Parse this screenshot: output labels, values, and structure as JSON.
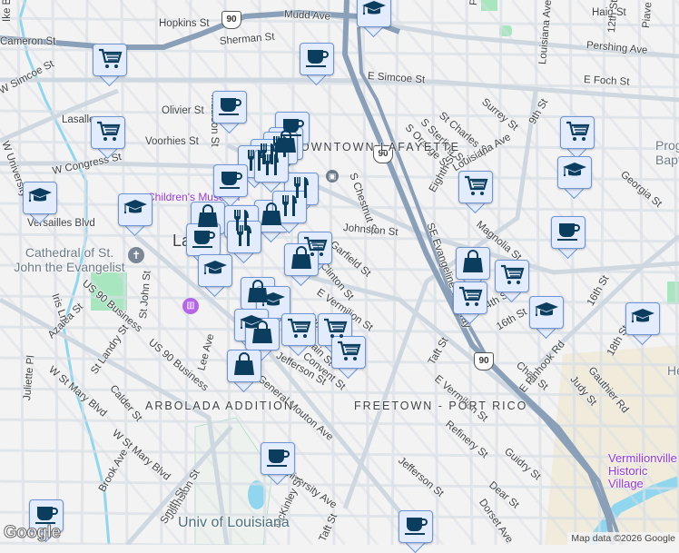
{
  "map": {
    "streets": [
      "Hopkins St",
      "Mudd Ave",
      "Cameron St",
      "Sherman St",
      "W Simcoe St",
      "E Simcoe St",
      "Olivier St",
      "Voorhies St",
      "Lasalle",
      "Madison St",
      "W Congress St",
      "W University",
      "Versailles Blvd",
      "Haig St",
      "Pershing Ave",
      "E Foch St",
      "Louisiana Ave",
      "Park Ave",
      "12th St",
      "Piave St",
      "Surrey St",
      "9th St",
      "St Charles St",
      "S Sterling St",
      "S Orange St",
      "S Chestnut St",
      "Eighth St",
      "Louisiana Ave",
      "Magnolia St",
      "Georgia St",
      "Johnston St",
      "SE Evangeline Thruway",
      "Garfield St",
      "Clinton St",
      "E Vermilion St",
      "Jackson St",
      "E Main St",
      "Convent St",
      "Jefferson St",
      "14th St",
      "16th St",
      "16th St",
      "Chag St",
      "E Pinhook Rd",
      "Judy St",
      "Gauthier Rd",
      "18th St",
      "Taft St",
      "E Vermilion St",
      "Refinery St",
      "Guidry St",
      "Dear St",
      "Dorset Ave",
      "Jefferson St",
      "US 90 Business",
      "US 90 Business",
      "St John St",
      "Lee Ave",
      "General Mouton Ave",
      "Azalea St",
      "Iris Ln",
      "St Landry St",
      "Calder St",
      "W St Mary Blvd",
      "W St Mary Blvd",
      "Juliette Pl",
      "Brook Ave",
      "Johnston St",
      "Smith St",
      "University Ave",
      "McKinley St",
      "Taft St",
      "Ike B St"
    ],
    "neighborhoods": [
      "DOWNTOWN LAFAYETTE",
      "ARBOLADA ADDITION",
      "FREETOWN - PORT RICO"
    ],
    "places": [
      "Children's Museum",
      "Cathedral of St. John the Evangelist",
      "Vermilionville Historic Village",
      "Univ of Louisiana",
      "Progressive Baptist",
      "He",
      "Lafayette"
    ],
    "highway_shields": [
      "90",
      "90",
      "90"
    ],
    "markers": [
      {
        "type": "school"
      },
      {
        "type": "cart"
      },
      {
        "type": "coffee"
      },
      {
        "type": "coffee"
      },
      {
        "type": "cart"
      },
      {
        "type": "coffee"
      },
      {
        "type": "bag"
      },
      {
        "type": "restaurant"
      },
      {
        "type": "restaurant"
      },
      {
        "type": "restaurant"
      },
      {
        "type": "restaurant"
      },
      {
        "type": "coffee"
      },
      {
        "type": "restaurant"
      },
      {
        "type": "bag"
      },
      {
        "type": "restaurant"
      },
      {
        "type": "bag"
      },
      {
        "type": "coffee"
      },
      {
        "type": "school"
      },
      {
        "type": "cart"
      },
      {
        "type": "bag"
      },
      {
        "type": "restaurant"
      },
      {
        "type": "restaurant"
      },
      {
        "type": "cart"
      },
      {
        "type": "cart"
      },
      {
        "type": "school"
      },
      {
        "type": "coffee"
      },
      {
        "type": "bag"
      },
      {
        "type": "cart"
      },
      {
        "type": "cart"
      },
      {
        "type": "school"
      },
      {
        "type": "school"
      },
      {
        "type": "school"
      },
      {
        "type": "school"
      },
      {
        "type": "bag"
      },
      {
        "type": "school"
      },
      {
        "type": "school"
      },
      {
        "type": "bag"
      },
      {
        "type": "cart"
      },
      {
        "type": "cart"
      },
      {
        "type": "cart"
      },
      {
        "type": "bag"
      },
      {
        "type": "coffee"
      },
      {
        "type": "coffee"
      },
      {
        "type": "coffee"
      }
    ],
    "attribution": "Map data ©2026 Google",
    "logo": "Google",
    "colors": {
      "marker_fill": "#e3ecfd",
      "marker_border": "#6d95d6",
      "icon": "#0b3d5e",
      "highway": "#8aa0b8",
      "road": "#d5dce3",
      "water": "#8fd6ee",
      "park": "#a8e6bf"
    }
  }
}
